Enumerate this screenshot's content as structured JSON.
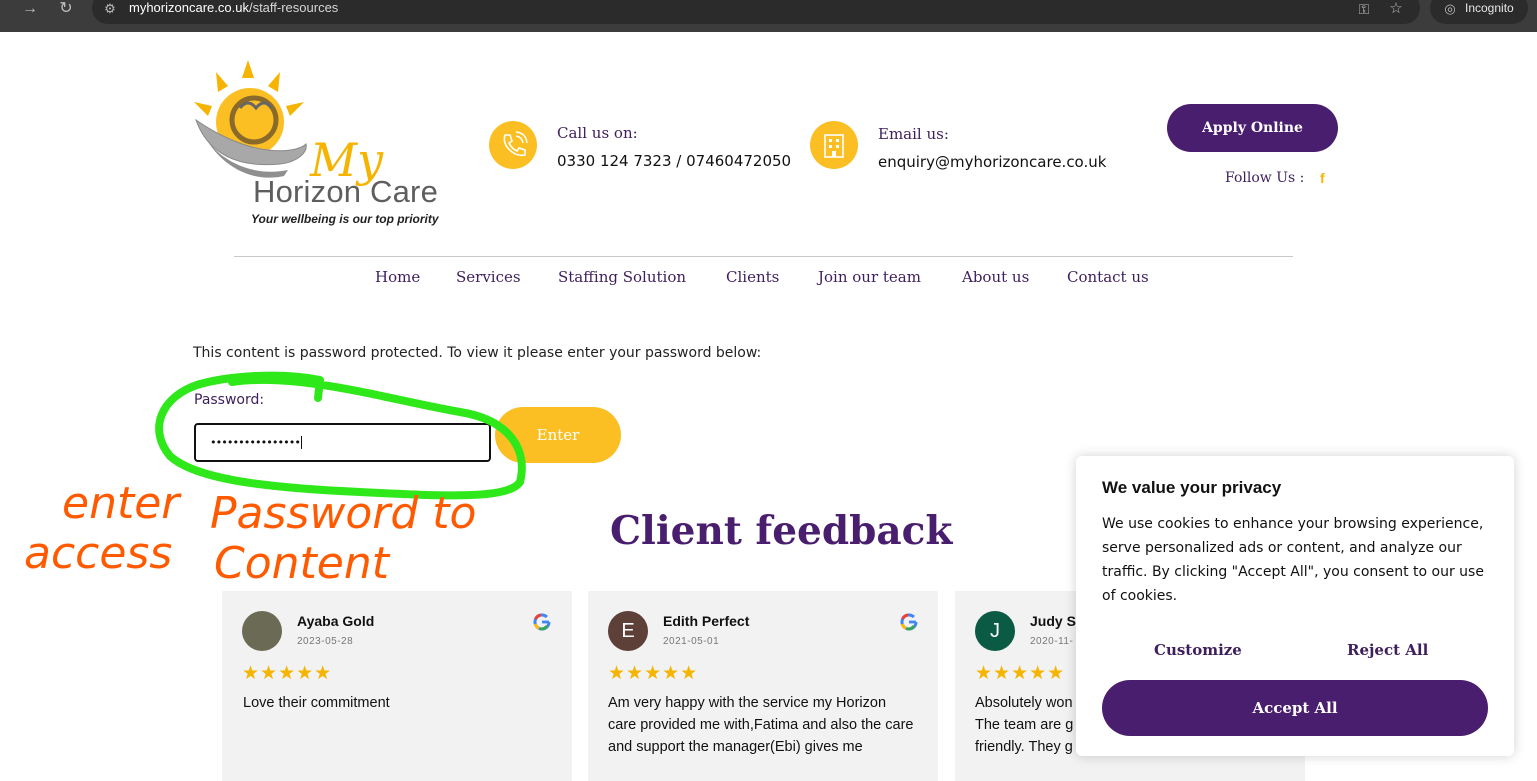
{
  "browser": {
    "url_domain": "myhorizoncare.co.uk",
    "url_path": "/staff-resources",
    "incognito_label": "Incognito"
  },
  "header": {
    "logo_title": "My",
    "logo_name": "Horizon Care",
    "logo_tagline": "Your wellbeing is our top priority",
    "call_title": "Call us on:",
    "call_value": "0330 124 7323 / 07460472050",
    "email_title": "Email us:",
    "email_value": "enquiry@myhorizoncare.co.uk",
    "apply_label": "Apply Online",
    "follow_label": "Follow Us :",
    "facebook_glyph": "f"
  },
  "nav": {
    "items": [
      "Home",
      "Services",
      "Staffing Solution",
      "Clients",
      "Join our team",
      "About us",
      "Contact us"
    ]
  },
  "protected": {
    "message": "This content is password protected. To view it please enter your password below:",
    "password_label": "Password:",
    "password_value": "••••••••••••••••",
    "enter_label": "Enter"
  },
  "annotation": {
    "lines": [
      "enter",
      "Password to",
      "access",
      "Content"
    ]
  },
  "feedback": {
    "title": "Client feedback",
    "reviews": [
      {
        "name": "Ayaba Gold",
        "date": "2023-05-28",
        "stars": "★★★★★",
        "text": "Love their commitment",
        "avatar": ""
      },
      {
        "name": "Edith Perfect",
        "date": "2021-05-01",
        "stars": "★★★★★",
        "text": "Am very happy with the service my Horizon care provided me with,Fatima and also the care and support the manager(Ebi) gives me",
        "avatar": "E"
      },
      {
        "name": "Judy St",
        "date": "2020-11-",
        "stars": "★★★★★",
        "text": "Absolutely won The team are g friendly. They g",
        "avatar": "J"
      }
    ]
  },
  "cookie": {
    "title": "We value your privacy",
    "text": "We use cookies to enhance your browsing experience, serve personalized ads or content, and analyze our traffic. By clicking \"Accept All\", you consent to our use of cookies.",
    "customize_label": "Customize",
    "reject_label": "Reject All",
    "accept_label": "Accept All"
  },
  "colors": {
    "brand_purple": "#4a1e6e",
    "brand_yellow": "#fbbf24",
    "annotation_green": "#2ee81a",
    "annotation_orange": "#ff5a00"
  }
}
